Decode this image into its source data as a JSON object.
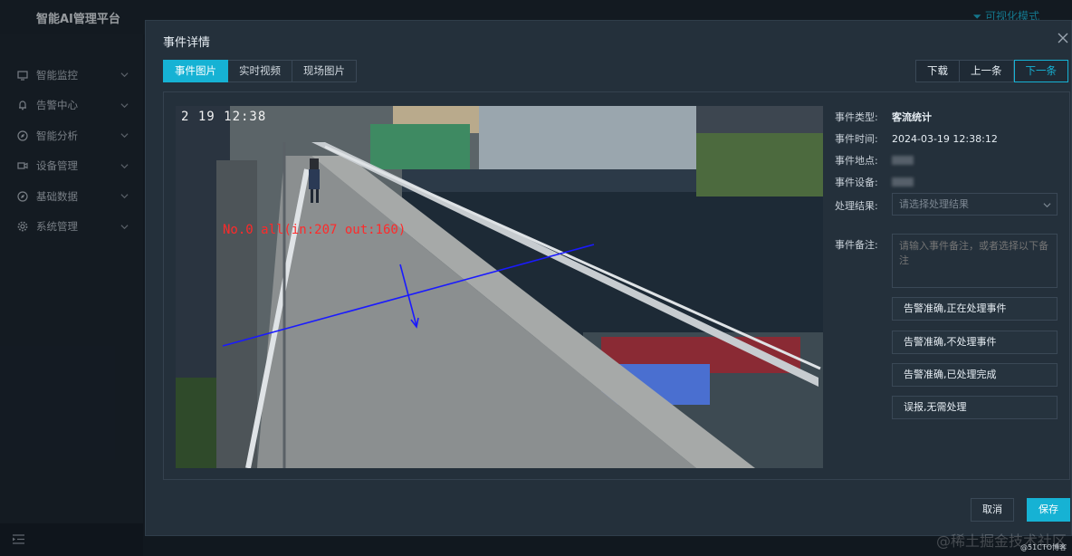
{
  "app": {
    "title": "智能AI管理平台",
    "mode_label": "可视化模式"
  },
  "sidebar": {
    "items": [
      {
        "label": "智能监控",
        "icon": "monitor-icon"
      },
      {
        "label": "告警中心",
        "icon": "bell-icon"
      },
      {
        "label": "智能分析",
        "icon": "compass-icon"
      },
      {
        "label": "设备管理",
        "icon": "camera-icon"
      },
      {
        "label": "基础数据",
        "icon": "compass-icon"
      },
      {
        "label": "系统管理",
        "icon": "gear-icon"
      }
    ]
  },
  "modal": {
    "title": "事件详情",
    "tabs": [
      {
        "label": "事件图片",
        "active": true
      },
      {
        "label": "实时视频",
        "active": false
      },
      {
        "label": "现场图片",
        "active": false
      }
    ],
    "nav": {
      "download": "下载",
      "prev": "上一条",
      "next": "下一条"
    },
    "photo": {
      "timestamp": "2 19 12:38",
      "counter": "No.0  all(in:207 out:160)"
    },
    "details": {
      "type_label": "事件类型:",
      "type_value": "客流统计",
      "time_label": "事件时间:",
      "time_value": "2024-03-19 12:38:12",
      "location_label": "事件地点:",
      "device_label": "事件设备:",
      "result_label": "处理结果:",
      "result_placeholder": "请选择处理结果",
      "remark_label": "事件备注:",
      "remark_placeholder": "请输入事件备注，或者选择以下备注"
    },
    "quick_options": [
      "告警准确,正在处理事件",
      "告警准确,不处理事件",
      "告警准确,已处理完成",
      "误报,无需处理"
    ],
    "footer": {
      "cancel": "取消",
      "save": "保存"
    }
  },
  "watermarks": {
    "juejin": "@稀土掘金技术社区",
    "cto": "@51CTO博客"
  },
  "colors": {
    "accent": "#16b2d4",
    "count_text": "#ff2a2a",
    "line": "#1a1aff"
  }
}
